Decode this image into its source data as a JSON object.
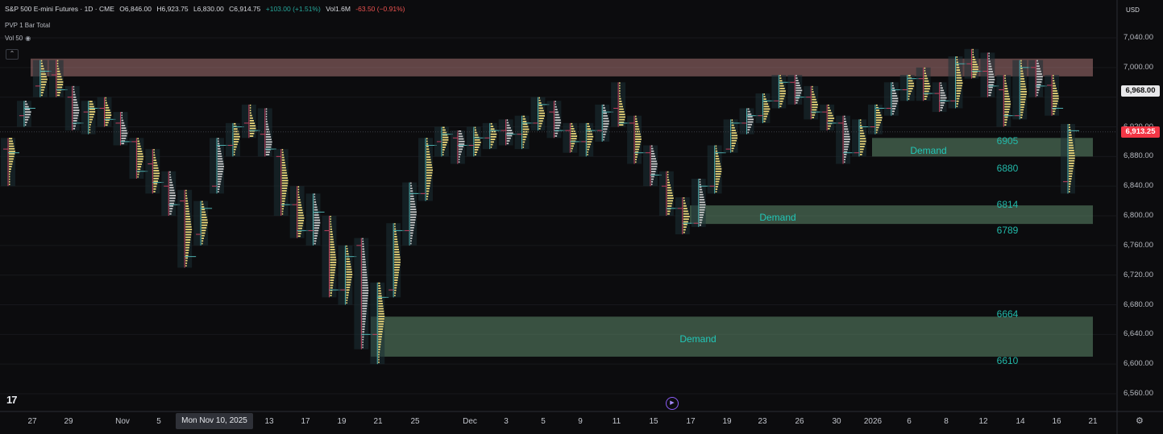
{
  "header": {
    "symbol": "S&P 500 E-mini Futures · 1D · CME",
    "open": "O6,846.00",
    "high": "H6,923.75",
    "low": "L6,830.00",
    "close": "C6,914.75",
    "change": "+103.00 (+1.51%)",
    "volume": "Vol1.6M",
    "change2": "-63.50 (−0.91%)",
    "indicator1": "PVP 1 Bar Total",
    "indicator2": "Vol 50"
  },
  "price_axis": {
    "currency": "USD",
    "current_price": "6,913.25",
    "marker_price": "6,968.00",
    "colors": {
      "current": "#f23645",
      "marker": "#e8e8ea"
    }
  },
  "time_axis": {
    "crosshair_label": "Mon Nov 10, 2025"
  },
  "zones": [
    {
      "label": "Demand",
      "top_text": "6905",
      "bottom_text": "6880"
    },
    {
      "label": "Demand",
      "top_text": "6814",
      "bottom_text": "6789"
    },
    {
      "label": "Demand",
      "top_text": "6664",
      "bottom_text": "6610"
    }
  ],
  "icons": {
    "logo": "tradingview-logo-icon",
    "settings": "gear-icon",
    "replay": "replay-icon",
    "eye": "eye-icon"
  },
  "chart_data": {
    "type": "candlestick",
    "y_ticks": [
      7040,
      7000,
      6960,
      6920,
      6880,
      6840,
      6800,
      6760,
      6720,
      6680,
      6640,
      6600,
      6560
    ],
    "y_tick_labels": [
      "7,040.00",
      "7,000.00",
      "",
      "6,920.00",
      "6,880.00",
      "6,840.00",
      "6,800.00",
      "6,760.00",
      "6,720.00",
      "6,680.00",
      "6,640.00",
      "6,600.00",
      "6,560.00"
    ],
    "ylim": [
      6545,
      7060
    ],
    "x_ticks": [
      "27",
      "29",
      "Nov",
      "5",
      "13",
      "17",
      "19",
      "21",
      "25",
      "Dec",
      "3",
      "5",
      "9",
      "11",
      "15",
      "17",
      "19",
      "23",
      "26",
      "30",
      "2026",
      "6",
      "8",
      "12",
      "14",
      "16",
      "21"
    ],
    "current_price": 6913.25,
    "supply_zone": [
      6988,
      7012
    ],
    "demand_zones": [
      [
        6880,
        6905
      ],
      [
        6789,
        6814
      ],
      [
        6610,
        6664
      ]
    ],
    "candles": [
      [
        6890,
        6905,
        6840,
        6885
      ],
      [
        6935,
        6955,
        6920,
        6945
      ],
      [
        6975,
        7010,
        6960,
        6995
      ],
      [
        6990,
        7010,
        6960,
        6970
      ],
      [
        6960,
        6975,
        6915,
        6925
      ],
      [
        6940,
        6955,
        6910,
        6945
      ],
      [
        6945,
        6960,
        6920,
        6930
      ],
      [
        6925,
        6940,
        6895,
        6900
      ],
      [
        6900,
        6905,
        6850,
        6860
      ],
      [
        6870,
        6890,
        6830,
        6845
      ],
      [
        6840,
        6860,
        6800,
        6815
      ],
      [
        6820,
        6835,
        6730,
        6745
      ],
      [
        6775,
        6820,
        6760,
        6810
      ],
      [
        6840,
        6905,
        6830,
        6895
      ],
      [
        6895,
        6925,
        6880,
        6920
      ],
      [
        6925,
        6950,
        6905,
        6915
      ],
      [
        6910,
        6945,
        6880,
        6890
      ],
      [
        6880,
        6890,
        6800,
        6815
      ],
      [
        6815,
        6840,
        6770,
        6780
      ],
      [
        6780,
        6830,
        6760,
        6805
      ],
      [
        6780,
        6800,
        6690,
        6700
      ],
      [
        6700,
        6760,
        6680,
        6745
      ],
      [
        6760,
        6770,
        6620,
        6640
      ],
      [
        6640,
        6710,
        6600,
        6690
      ],
      [
        6700,
        6790,
        6690,
        6780
      ],
      [
        6780,
        6845,
        6760,
        6830
      ],
      [
        6830,
        6905,
        6820,
        6895
      ],
      [
        6900,
        6920,
        6880,
        6910
      ],
      [
        6905,
        6915,
        6870,
        6895
      ],
      [
        6895,
        6920,
        6880,
        6905
      ],
      [
        6905,
        6925,
        6890,
        6915
      ],
      [
        6915,
        6930,
        6895,
        6910
      ],
      [
        6910,
        6935,
        6890,
        6925
      ],
      [
        6925,
        6960,
        6915,
        6950
      ],
      [
        6940,
        6955,
        6905,
        6915
      ],
      [
        6915,
        6925,
        6885,
        6900
      ],
      [
        6900,
        6925,
        6880,
        6915
      ],
      [
        6915,
        6950,
        6900,
        6940
      ],
      [
        6945,
        6980,
        6920,
        6925
      ],
      [
        6925,
        6935,
        6870,
        6885
      ],
      [
        6885,
        6895,
        6840,
        6855
      ],
      [
        6840,
        6860,
        6800,
        6810
      ],
      [
        6810,
        6825,
        6775,
        6790
      ],
      [
        6790,
        6850,
        6785,
        6840
      ],
      [
        6840,
        6895,
        6830,
        6885
      ],
      [
        6890,
        6930,
        6885,
        6925
      ],
      [
        6925,
        6945,
        6910,
        6935
      ],
      [
        6935,
        6965,
        6925,
        6955
      ],
      [
        6955,
        6990,
        6945,
        6980
      ],
      [
        6980,
        6990,
        6950,
        6960
      ],
      [
        6960,
        6975,
        6930,
        6940
      ],
      [
        6940,
        6950,
        6915,
        6925
      ],
      [
        6925,
        6935,
        6870,
        6885
      ],
      [
        6885,
        6930,
        6880,
        6920
      ],
      [
        6920,
        6950,
        6910,
        6945
      ],
      [
        6945,
        6980,
        6935,
        6970
      ],
      [
        6970,
        6990,
        6955,
        6985
      ],
      [
        6985,
        7000,
        6955,
        6965
      ],
      [
        6965,
        6980,
        6940,
        6955
      ],
      [
        6955,
        7015,
        6945,
        7005
      ],
      [
        7005,
        7025,
        6985,
        6995
      ],
      [
        6995,
        7020,
        6960,
        6975
      ],
      [
        6970,
        6990,
        6920,
        6935
      ],
      [
        6935,
        7010,
        6930,
        7000
      ],
      [
        7000,
        7010,
        6960,
        6975
      ],
      [
        6976,
        6990,
        6935,
        6945
      ],
      [
        6846,
        6923.75,
        6830,
        6914.75
      ]
    ]
  }
}
